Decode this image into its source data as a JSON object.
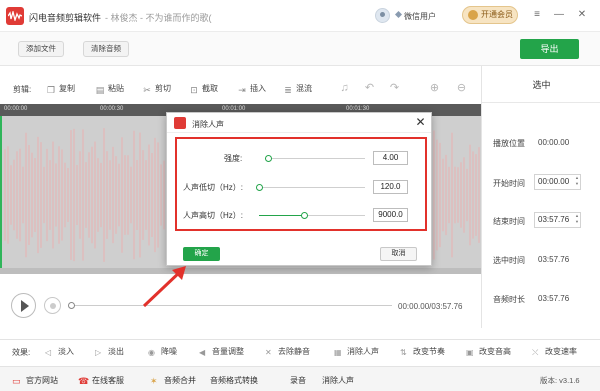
{
  "titlebar": {
    "app_name": "闪电音频剪辑软件",
    "song": "- 林俊杰 - 不为谁而作的歌(",
    "user": "微信用户",
    "vip_label": "开通会员"
  },
  "toolbar": {
    "add_file": "添加文件",
    "clear_audio": "清除音频",
    "export": "导出"
  },
  "edit_bar": {
    "label": "剪辑:",
    "tools": [
      "复制",
      "粘贴",
      "剪切",
      "截取",
      "插入",
      "混流"
    ]
  },
  "ruler": {
    "labels": [
      "00:00:00",
      "00:00:30",
      "00:01:00",
      "00:01:30"
    ]
  },
  "selection_panel": {
    "title": "选中",
    "playback_position_label": "播放位置",
    "playback_position": "00:00.00",
    "start_time_label": "开始时间",
    "start_time": "00:00.00",
    "end_time_label": "结束时间",
    "end_time": "03:57.76",
    "selection_duration_label": "选中时间",
    "selection_duration": "03:57.76",
    "audio_duration_label": "音频时长",
    "audio_duration": "03:57.76"
  },
  "player": {
    "time": "00:00.00/03:57.76",
    "progress": 0.0
  },
  "effects": {
    "label": "效果:",
    "items": [
      "淡入",
      "淡出",
      "降噪",
      "音量调整",
      "去除静音",
      "消除人声",
      "改变节奏",
      "改变音高",
      "改变速率"
    ]
  },
  "footer": {
    "items": [
      "官方网站",
      "在线客服",
      "音频合并",
      "音频格式转换",
      "录音",
      "消除人声"
    ],
    "version": "版本: v3.1.6"
  },
  "dialog": {
    "title": "消除人声",
    "params": [
      {
        "label": "强度:",
        "value": "4.00",
        "fraction": 0.03
      },
      {
        "label": "人声低切（Hz）:",
        "value": "120.0",
        "fraction": 0.0
      },
      {
        "label": "人声高切（Hz）:",
        "value": "9000.0",
        "fraction": 0.42
      }
    ],
    "ok": "确定",
    "cancel": "取消"
  },
  "colors": {
    "accent_green": "#23a44a",
    "highlight_red": "#e2312b",
    "waveform": "#e8b2b2"
  }
}
